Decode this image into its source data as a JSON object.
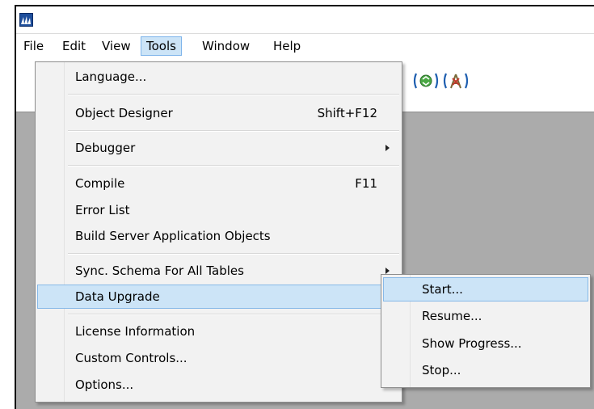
{
  "menubar": {
    "items": [
      {
        "label": "File",
        "id": "file"
      },
      {
        "label": "Edit",
        "id": "edit"
      },
      {
        "label": "View",
        "id": "view"
      },
      {
        "label": "Tools",
        "id": "tools",
        "active": true
      },
      {
        "label": "Window",
        "id": "window"
      },
      {
        "label": "Help",
        "id": "help"
      }
    ]
  },
  "toolbar": {
    "icons": [
      "database-icon",
      "sync-icon",
      "antenna-icon"
    ]
  },
  "tools_menu": {
    "items": [
      {
        "label": "Language...",
        "shortcut": ""
      },
      {
        "label": "Object Designer",
        "shortcut": "Shift+F12"
      },
      {
        "label": "Debugger",
        "shortcut": "",
        "submenu": true
      },
      {
        "label": "Compile",
        "shortcut": "F11"
      },
      {
        "label": "Error List",
        "shortcut": ""
      },
      {
        "label": "Build Server Application Objects",
        "shortcut": ""
      },
      {
        "label": "Sync. Schema For All Tables",
        "shortcut": "",
        "submenu": true
      },
      {
        "label": "Data Upgrade",
        "shortcut": "",
        "submenu": true,
        "highlighted": true
      },
      {
        "label": "License Information",
        "shortcut": ""
      },
      {
        "label": "Custom Controls...",
        "shortcut": ""
      },
      {
        "label": "Options...",
        "shortcut": ""
      }
    ]
  },
  "data_upgrade_submenu": {
    "items": [
      {
        "label": "Start...",
        "highlighted": true
      },
      {
        "label": "Resume..."
      },
      {
        "label": "Show Progress..."
      },
      {
        "label": "Stop..."
      }
    ]
  },
  "colors": {
    "highlight_bg": "#cce4f7",
    "highlight_border": "#87b9e8",
    "menu_bg": "#f2f2f2",
    "workspace_bg": "#ababab"
  }
}
